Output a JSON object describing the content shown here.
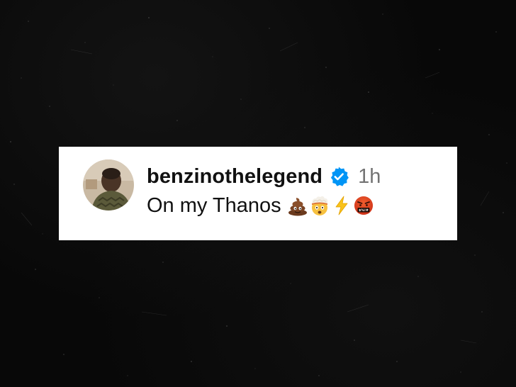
{
  "comment": {
    "username": "benzinothelegend",
    "verified": true,
    "timestamp": "1h",
    "text": "On my Thanos",
    "emojis": [
      "poop-emoji",
      "exploding-head-emoji",
      "lightning-emoji",
      "cursing-face-emoji"
    ]
  },
  "colors": {
    "background": "#080808",
    "card": "#ffffff",
    "username": "#111111",
    "timestamp": "#737373",
    "verified_badge": "#0095f6"
  }
}
